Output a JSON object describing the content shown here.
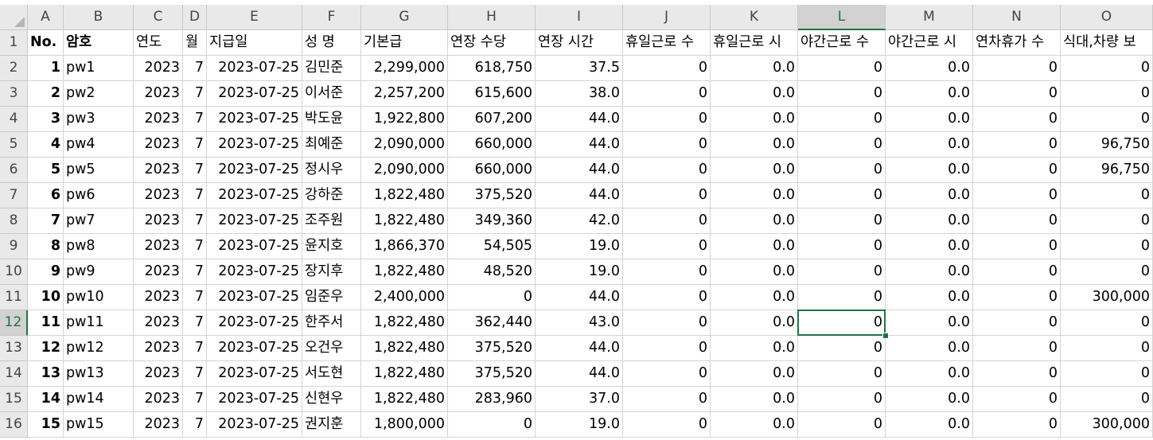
{
  "columns": [
    "A",
    "B",
    "C",
    "D",
    "E",
    "F",
    "G",
    "H",
    "I",
    "J",
    "K",
    "L",
    "M",
    "N",
    "O"
  ],
  "headers": [
    "No.",
    "암호",
    "연도",
    "월",
    "지급일",
    "성 명",
    "기본급",
    "연장 수당",
    "연장 시간",
    "휴일근로 수",
    "휴일근로 시",
    "야간근로 수",
    "야간근로 시",
    "연차휴가 수",
    "식대,차량 보"
  ],
  "rows": [
    [
      "1",
      "pw1",
      "2023",
      "7",
      "2023-07-25",
      "김민준",
      "2,299,000",
      "618,750",
      "37.5",
      "0",
      "0.0",
      "0",
      "0.0",
      "0",
      "0"
    ],
    [
      "2",
      "pw2",
      "2023",
      "7",
      "2023-07-25",
      "이서준",
      "2,257,200",
      "615,600",
      "38.0",
      "0",
      "0.0",
      "0",
      "0.0",
      "0",
      "0"
    ],
    [
      "3",
      "pw3",
      "2023",
      "7",
      "2023-07-25",
      "박도윤",
      "1,922,800",
      "607,200",
      "44.0",
      "0",
      "0.0",
      "0",
      "0.0",
      "0",
      "0"
    ],
    [
      "4",
      "pw4",
      "2023",
      "7",
      "2023-07-25",
      "최예준",
      "2,090,000",
      "660,000",
      "44.0",
      "0",
      "0.0",
      "0",
      "0.0",
      "0",
      "96,750"
    ],
    [
      "5",
      "pw5",
      "2023",
      "7",
      "2023-07-25",
      "정시우",
      "2,090,000",
      "660,000",
      "44.0",
      "0",
      "0.0",
      "0",
      "0.0",
      "0",
      "96,750"
    ],
    [
      "6",
      "pw6",
      "2023",
      "7",
      "2023-07-25",
      "강하준",
      "1,822,480",
      "375,520",
      "44.0",
      "0",
      "0.0",
      "0",
      "0.0",
      "0",
      "0"
    ],
    [
      "7",
      "pw7",
      "2023",
      "7",
      "2023-07-25",
      "조주원",
      "1,822,480",
      "349,360",
      "42.0",
      "0",
      "0.0",
      "0",
      "0.0",
      "0",
      "0"
    ],
    [
      "8",
      "pw8",
      "2023",
      "7",
      "2023-07-25",
      "윤지호",
      "1,866,370",
      "54,505",
      "19.0",
      "0",
      "0.0",
      "0",
      "0.0",
      "0",
      "0"
    ],
    [
      "9",
      "pw9",
      "2023",
      "7",
      "2023-07-25",
      "장지후",
      "1,822,480",
      "48,520",
      "19.0",
      "0",
      "0.0",
      "0",
      "0.0",
      "0",
      "0"
    ],
    [
      "10",
      "pw10",
      "2023",
      "7",
      "2023-07-25",
      "임준우",
      "2,400,000",
      "0",
      "44.0",
      "0",
      "0.0",
      "0",
      "0.0",
      "0",
      "300,000"
    ],
    [
      "11",
      "pw11",
      "2023",
      "7",
      "2023-07-25",
      "한주서",
      "1,822,480",
      "362,440",
      "43.0",
      "0",
      "0.0",
      "0",
      "0.0",
      "0",
      "0"
    ],
    [
      "12",
      "pw12",
      "2023",
      "7",
      "2023-07-25",
      "오건우",
      "1,822,480",
      "375,520",
      "44.0",
      "0",
      "0.0",
      "0",
      "0.0",
      "0",
      "0"
    ],
    [
      "13",
      "pw13",
      "2023",
      "7",
      "2023-07-25",
      "서도현",
      "1,822,480",
      "375,520",
      "44.0",
      "0",
      "0.0",
      "0",
      "0.0",
      "0",
      "0"
    ],
    [
      "14",
      "pw14",
      "2023",
      "7",
      "2023-07-25",
      "신현우",
      "1,822,480",
      "283,960",
      "37.0",
      "0",
      "0.0",
      "0",
      "0.0",
      "0",
      "0"
    ],
    [
      "15",
      "pw15",
      "2023",
      "7",
      "2023-07-25",
      "권지훈",
      "1,800,000",
      "0",
      "19.0",
      "0",
      "0.0",
      "0",
      "0.0",
      "0",
      "300,000"
    ]
  ],
  "row_numbers": [
    "1",
    "2",
    "3",
    "4",
    "5",
    "6",
    "7",
    "8",
    "9",
    "10",
    "11",
    "12",
    "13",
    "14",
    "15",
    "16"
  ],
  "selected_cell": "L12",
  "colors": {
    "accent": "#217346",
    "header_bg": "#e9e9e9",
    "grid_line": "#d4d4d4"
  }
}
